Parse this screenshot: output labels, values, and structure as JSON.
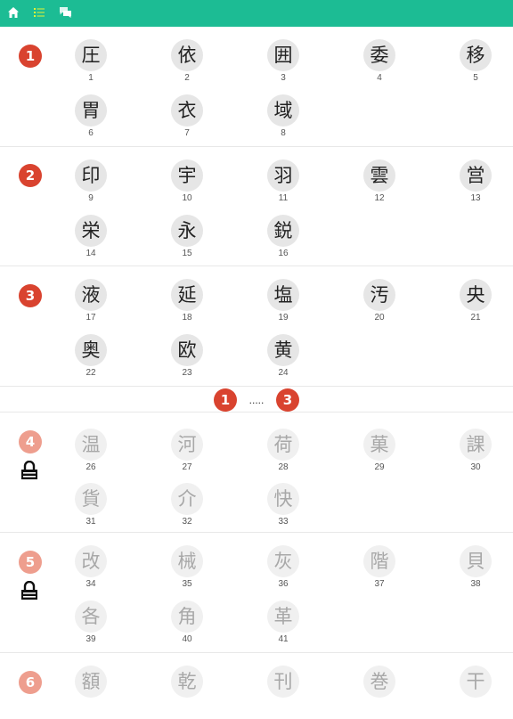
{
  "colors": {
    "toolbar": "#1cbc94",
    "badge_active": "#d9432f",
    "badge_locked": "#ee9e8e",
    "kanji_bg": "#e6e6e6"
  },
  "toolbar": {
    "icons": [
      "home-icon",
      "list-icon",
      "chat-icon"
    ],
    "active_icon": "list-icon"
  },
  "lessons": [
    {
      "number": "1",
      "locked": false,
      "kanji": [
        {
          "char": "圧",
          "num": "1"
        },
        {
          "char": "依",
          "num": "2"
        },
        {
          "char": "囲",
          "num": "3"
        },
        {
          "char": "委",
          "num": "4"
        },
        {
          "char": "移",
          "num": "5"
        },
        {
          "char": "胃",
          "num": "6"
        },
        {
          "char": "衣",
          "num": "7"
        },
        {
          "char": "域",
          "num": "8"
        }
      ]
    },
    {
      "number": "2",
      "locked": false,
      "kanji": [
        {
          "char": "印",
          "num": "9"
        },
        {
          "char": "宇",
          "num": "10"
        },
        {
          "char": "羽",
          "num": "11"
        },
        {
          "char": "雲",
          "num": "12"
        },
        {
          "char": "営",
          "num": "13"
        },
        {
          "char": "栄",
          "num": "14"
        },
        {
          "char": "永",
          "num": "15"
        },
        {
          "char": "鋭",
          "num": "16"
        }
      ]
    },
    {
      "number": "3",
      "locked": false,
      "kanji": [
        {
          "char": "液",
          "num": "17"
        },
        {
          "char": "延",
          "num": "18"
        },
        {
          "char": "塩",
          "num": "19"
        },
        {
          "char": "汚",
          "num": "20"
        },
        {
          "char": "央",
          "num": "21"
        },
        {
          "char": "奥",
          "num": "22"
        },
        {
          "char": "欧",
          "num": "23"
        },
        {
          "char": "黄",
          "num": "24"
        }
      ]
    },
    {
      "number": "4",
      "locked": true,
      "kanji": [
        {
          "char": "温",
          "num": "26"
        },
        {
          "char": "河",
          "num": "27"
        },
        {
          "char": "荷",
          "num": "28"
        },
        {
          "char": "菓",
          "num": "29"
        },
        {
          "char": "課",
          "num": "30"
        },
        {
          "char": "貨",
          "num": "31"
        },
        {
          "char": "介",
          "num": "32"
        },
        {
          "char": "快",
          "num": "33"
        }
      ]
    },
    {
      "number": "5",
      "locked": true,
      "kanji": [
        {
          "char": "改",
          "num": "34"
        },
        {
          "char": "械",
          "num": "35"
        },
        {
          "char": "灰",
          "num": "36"
        },
        {
          "char": "階",
          "num": "37"
        },
        {
          "char": "貝",
          "num": "38"
        },
        {
          "char": "各",
          "num": "39"
        },
        {
          "char": "角",
          "num": "40"
        },
        {
          "char": "革",
          "num": "41"
        }
      ]
    },
    {
      "number": "6",
      "locked": true,
      "kanji": [
        {
          "char": "額"
        },
        {
          "char": "乾"
        },
        {
          "char": "刊"
        },
        {
          "char": "巻"
        },
        {
          "char": "干"
        }
      ]
    }
  ],
  "pager": {
    "first": "1",
    "dots": ".....",
    "last": "3"
  }
}
